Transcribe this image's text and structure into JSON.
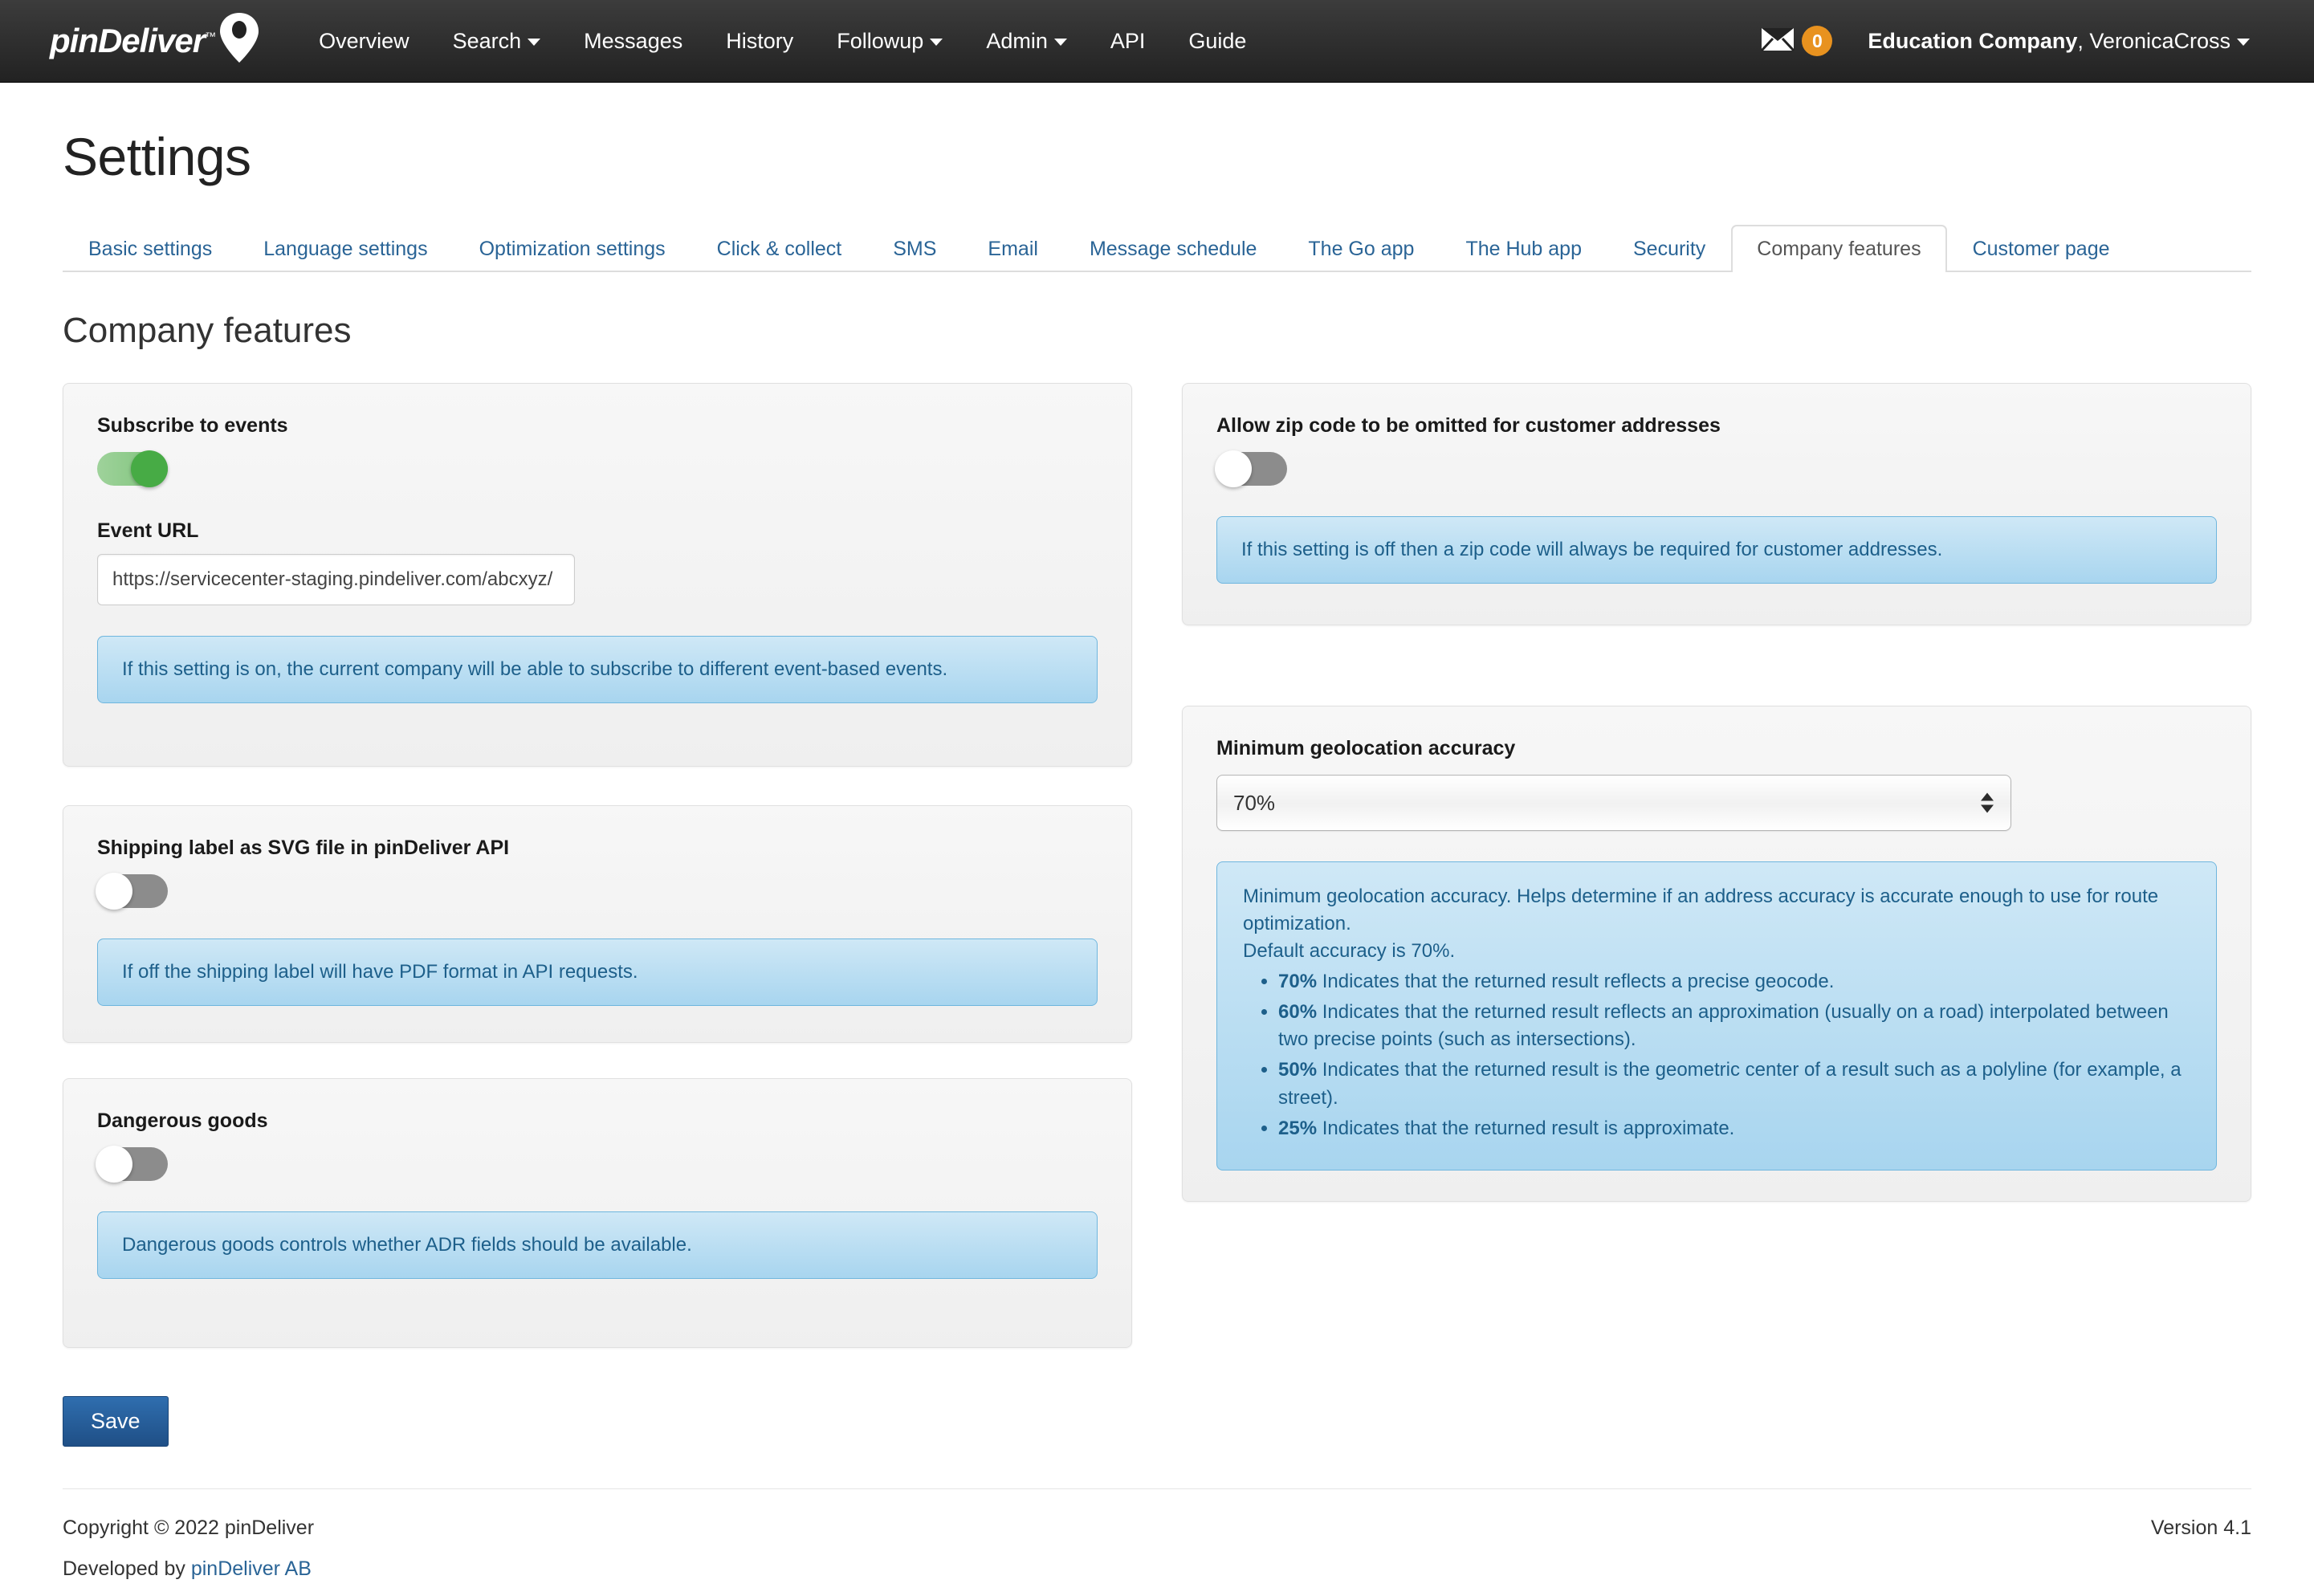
{
  "navbar": {
    "brand": {
      "name": "pinDeliver",
      "trademark": "™",
      "pin_icon": "map-pin-icon"
    },
    "links": [
      {
        "label": "Overview",
        "caret": false
      },
      {
        "label": "Search",
        "caret": true
      },
      {
        "label": "Messages",
        "caret": false
      },
      {
        "label": "History",
        "caret": false
      },
      {
        "label": "Followup",
        "caret": true
      },
      {
        "label": "Admin",
        "caret": true
      },
      {
        "label": "API",
        "caret": false
      },
      {
        "label": "Guide",
        "caret": false
      }
    ],
    "messages": {
      "icon": "envelope-icon",
      "count": "0"
    },
    "user": {
      "company": "Education Company",
      "separator": ", ",
      "name": "VeronicaCross"
    }
  },
  "page": {
    "title": "Settings",
    "section_title": "Company features"
  },
  "tabs": [
    {
      "label": "Basic settings",
      "active": false
    },
    {
      "label": "Language settings",
      "active": false
    },
    {
      "label": "Optimization settings",
      "active": false
    },
    {
      "label": "Click & collect",
      "active": false
    },
    {
      "label": "SMS",
      "active": false
    },
    {
      "label": "Email",
      "active": false
    },
    {
      "label": "Message schedule",
      "active": false
    },
    {
      "label": "The Go app",
      "active": false
    },
    {
      "label": "The Hub app",
      "active": false
    },
    {
      "label": "Security",
      "active": false
    },
    {
      "label": "Company features",
      "active": true
    },
    {
      "label": "Customer page",
      "active": false
    }
  ],
  "panels": {
    "subscribe_events": {
      "label": "Subscribe to events",
      "toggle_state": "on",
      "field_label": "Event URL",
      "field_value": "https://servicecenter-staging.pindeliver.com/abcxyz/",
      "field_placeholder": "",
      "info": "If this setting is on, the current company will be able to subscribe to different event-based events."
    },
    "zip_code": {
      "label": "Allow zip code to be omitted for customer addresses",
      "toggle_state": "off",
      "info": "If this setting is off then a zip code will always be required for customer addresses."
    },
    "shipping_label_svg": {
      "label": "Shipping label as SVG file in pinDeliver API",
      "toggle_state": "off",
      "info": "If off the shipping label will have PDF format in API requests."
    },
    "dangerous_goods": {
      "label": "Dangerous goods",
      "toggle_state": "off",
      "info": "Dangerous goods controls whether ADR fields should be available."
    },
    "geolocation": {
      "label": "Minimum geolocation accuracy",
      "selected_value": "70%",
      "options": [
        "70%",
        "60%",
        "50%",
        "25%"
      ],
      "info_line1": "Minimum geolocation accuracy. Helps determine if an address accuracy is accurate enough to use for route optimization.",
      "info_line2": "Default accuracy is 70%.",
      "bullets": [
        {
          "pct": "70%",
          "text": "Indicates that the returned result reflects a precise geocode."
        },
        {
          "pct": "60%",
          "text": "Indicates that the returned result reflects an approximation (usually on a road) interpolated between two precise points (such as intersections)."
        },
        {
          "pct": "50%",
          "text": "Indicates that the returned result is the geometric center of a result such as a polyline (for example, a street)."
        },
        {
          "pct": "25%",
          "text": "Indicates that the returned result is approximate."
        }
      ]
    }
  },
  "actions": {
    "save_label": "Save"
  },
  "footer": {
    "copyright": "Copyright © 2022 pinDeliver",
    "developed_by_prefix": "Developed by ",
    "developed_by_link": "pinDeliver AB",
    "version": "Version 4.1"
  },
  "colors": {
    "navbar_bg": "#222222",
    "accent_blue": "#2a6496",
    "badge_orange": "#e8921f",
    "toggle_on_green": "#47ab45",
    "toggle_off_gray": "#8c8c8c",
    "info_blue_bg": "#a8d5ef",
    "info_blue_text": "#1d5f8a",
    "save_blue": "#1f4f86"
  }
}
